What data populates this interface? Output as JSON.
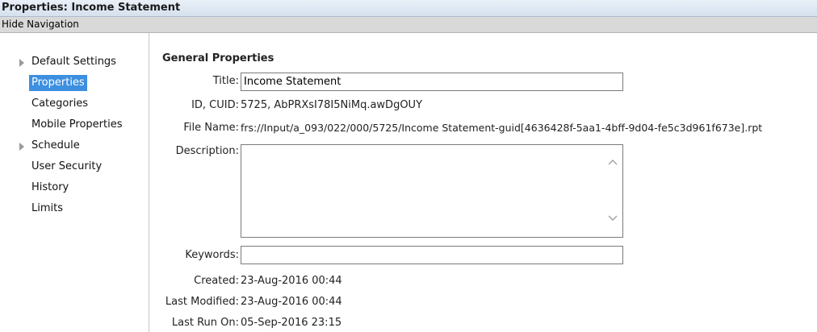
{
  "window": {
    "title": "Properties: Income Statement"
  },
  "navbar": {
    "hide_navigation": "Hide Navigation"
  },
  "sidebar": {
    "items": [
      {
        "label": "Default Settings",
        "expandable": true
      },
      {
        "label": "Properties",
        "selected": true
      },
      {
        "label": "Categories"
      },
      {
        "label": "Mobile Properties"
      },
      {
        "label": "Schedule",
        "expandable": true
      },
      {
        "label": "User Security"
      },
      {
        "label": "History"
      },
      {
        "label": "Limits"
      }
    ]
  },
  "general": {
    "section_title": "General Properties",
    "title_label": "Title:",
    "title_value": "Income Statement",
    "id_label": "ID, CUID:",
    "id_value": "5725, AbPRXsI78I5NiMq.awDgOUY",
    "filename_label": "File Name:",
    "filename_value": "frs://Input/a_093/022/000/5725/Income Statement-guid[4636428f-5aa1-4bff-9d04-fe5c3d961f673e].rpt",
    "description_label": "Description:",
    "description_value": "",
    "keywords_label": "Keywords:",
    "keywords_value": "",
    "created_label": "Created:",
    "created_value": "23-Aug-2016 00:44",
    "modified_label": "Last Modified:",
    "modified_value": "23-Aug-2016 00:44",
    "lastrun_label": "Last Run On:",
    "lastrun_value": "05-Sep-2016 23:15"
  },
  "colors": {
    "selected_bg": "#3d8fe0",
    "title_bar": "#dbe5f1",
    "nav_bar": "#d9d9d9"
  },
  "icons": {
    "expand": "triangle-right-icon",
    "scroll_up": "chevron-up-icon",
    "scroll_down": "chevron-down-icon"
  }
}
